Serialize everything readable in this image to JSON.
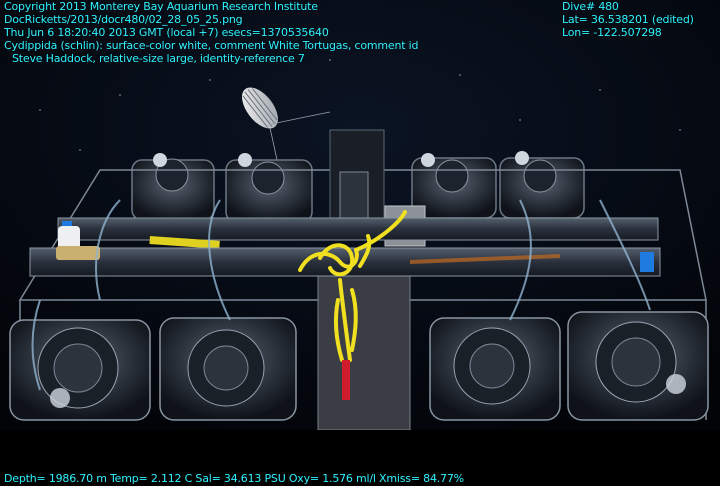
{
  "overlay": {
    "line1": "Copyright 2013 Monterey Bay Aquarium Research Institute",
    "line2": "DocRicketts/2013/docr480/02_28_05_25.png",
    "line3": "Thu Jun  6 18:20:40 2013 GMT (local +7)  esecs=1370535640",
    "line4": "Cydippida (schlin): surface-color white, comment White Tortugas, comment id",
    "line5": "Steve Haddock, relative-size large, identity-reference 7",
    "dive": "Dive# 480",
    "lat": "Lat= 36.538201 (edited)",
    "lon": "Lon= -122.507298",
    "sensors": "Depth= 1986.70 m  Temp= 2.112 C  Sal= 34.613 PSU  Oxy= 1.576 ml/l  Xmiss= 84.77%"
  },
  "colors": {
    "overlay_text": "#2ff3ff",
    "water": "#050a14",
    "rope": "#f0e020",
    "frame_metal": "#2a2f3a",
    "accent_blue": "#1f7be0"
  }
}
